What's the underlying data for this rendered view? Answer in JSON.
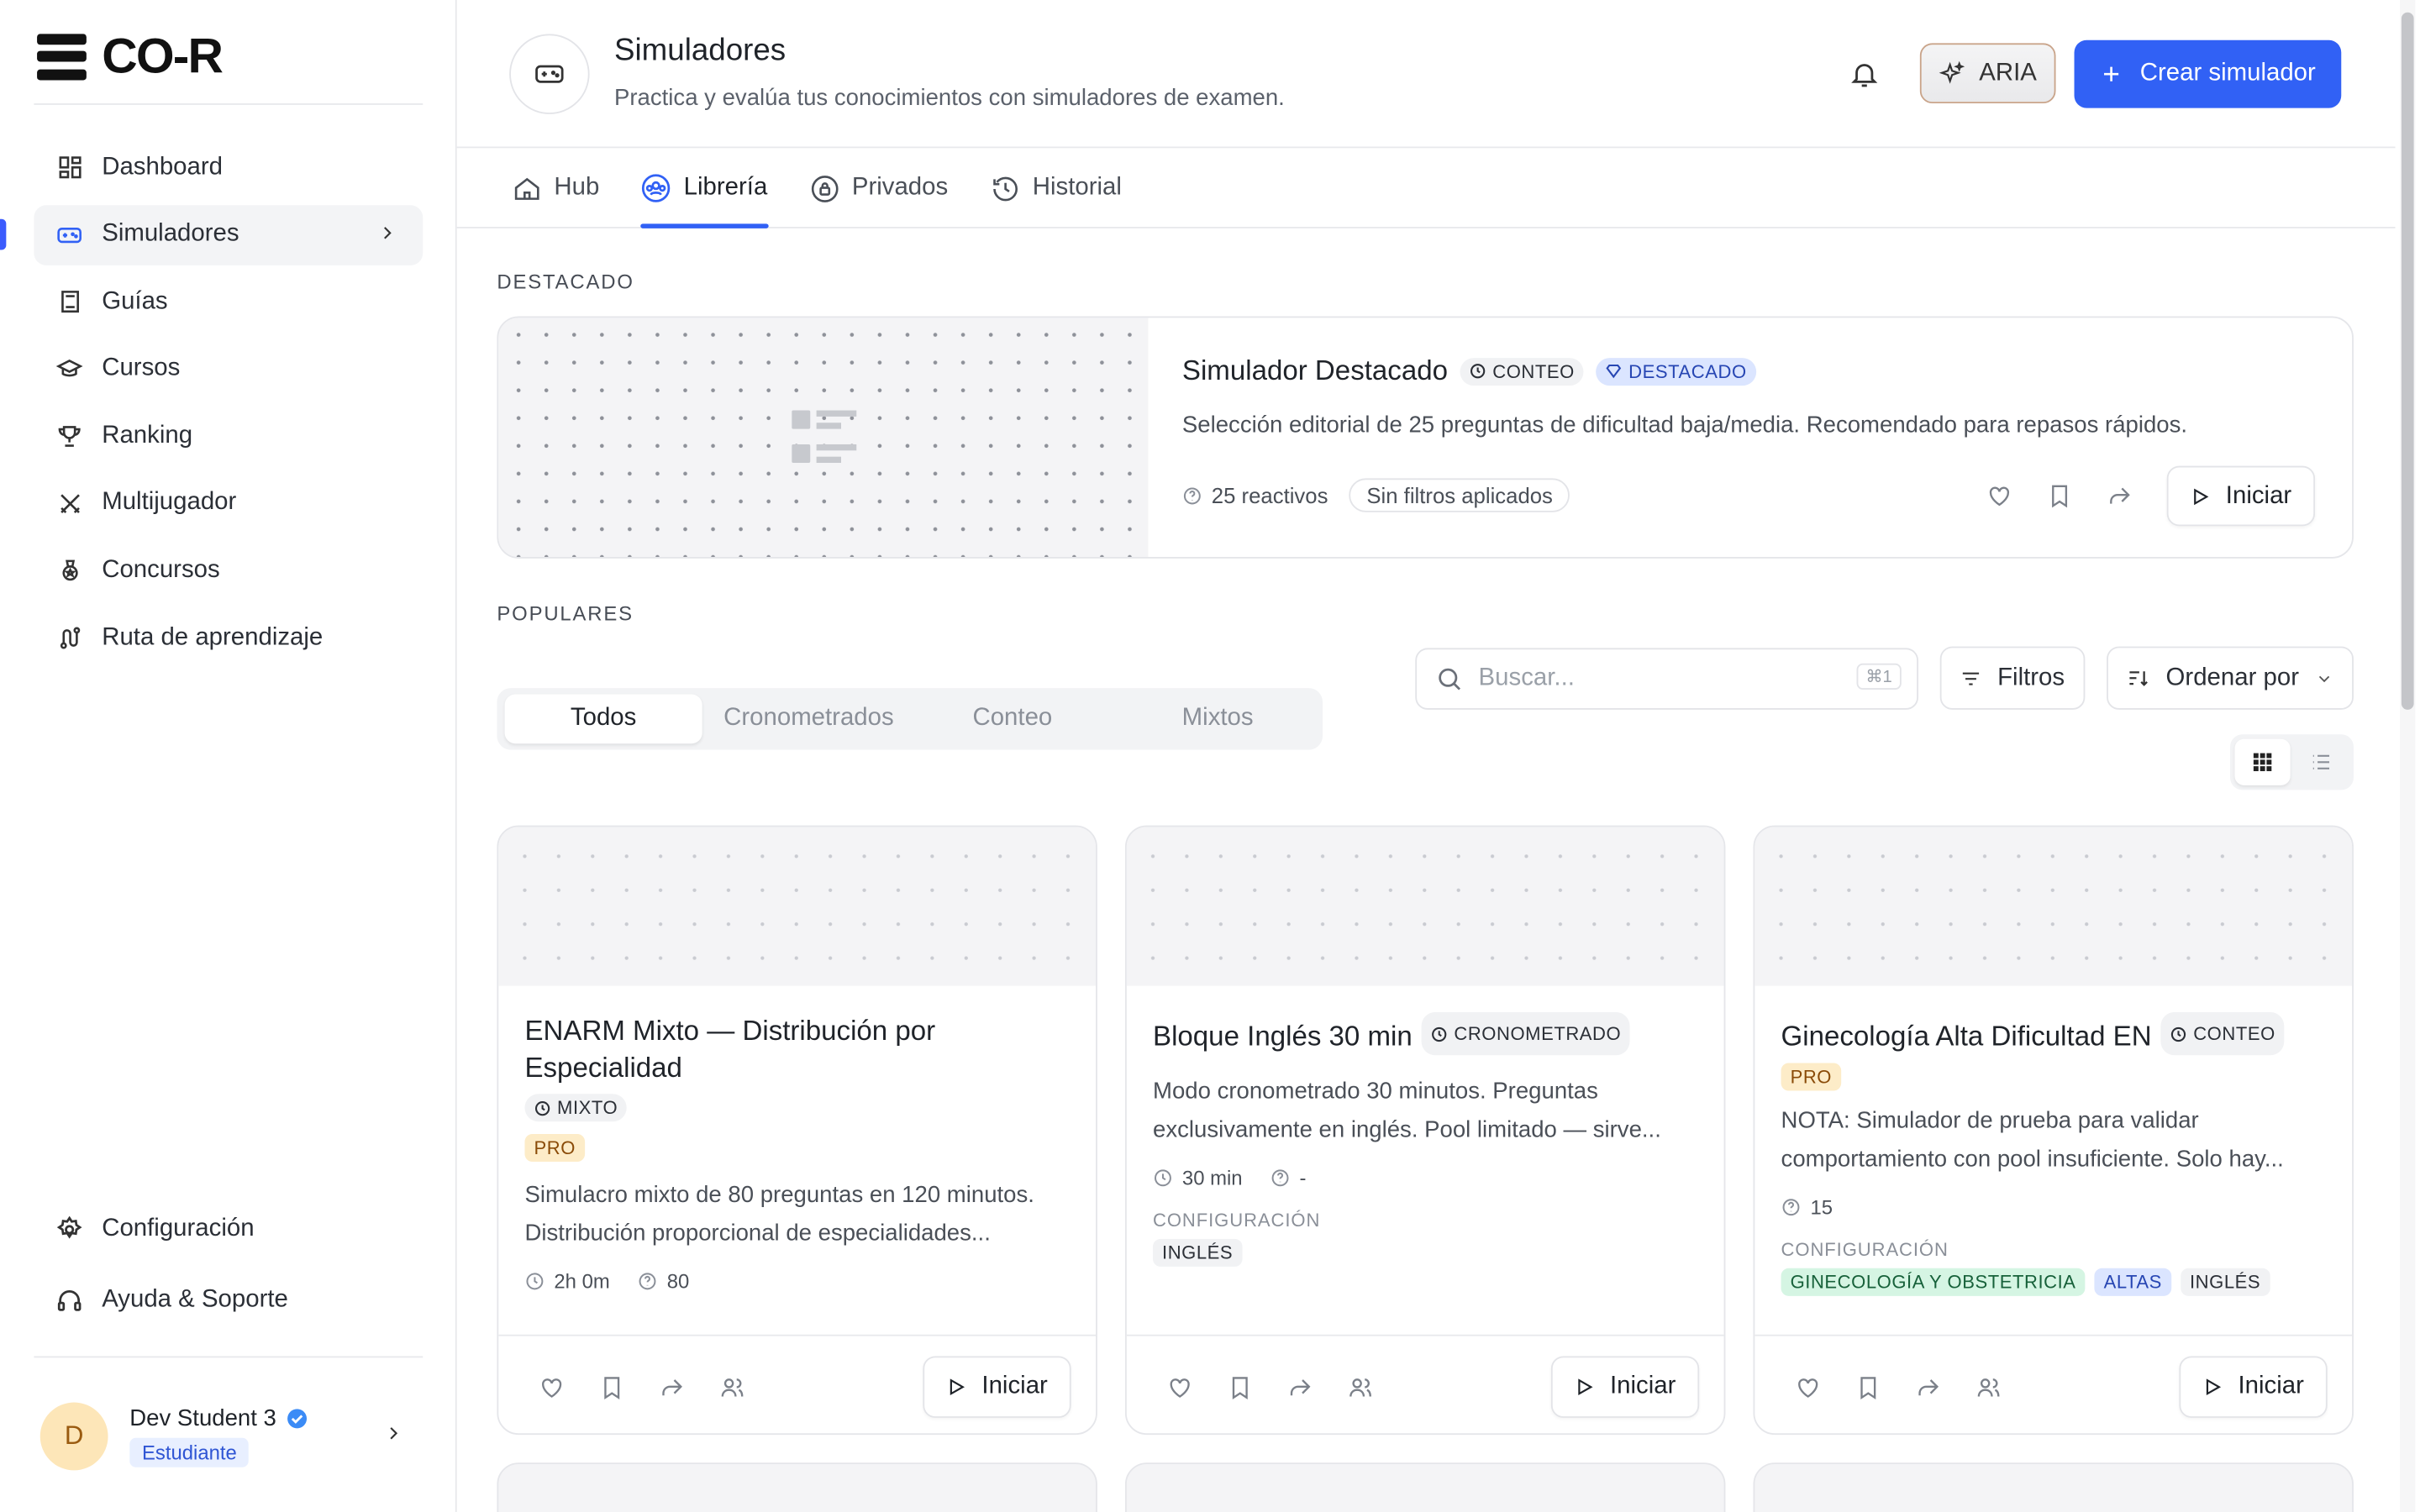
{
  "app": {
    "logo_text": "CO-R"
  },
  "sidebar": {
    "items": [
      {
        "label": "Dashboard",
        "icon": "dashboard-icon"
      },
      {
        "label": "Simuladores",
        "icon": "gamepad-icon",
        "active": true
      },
      {
        "label": "Guías",
        "icon": "book-icon"
      },
      {
        "label": "Cursos",
        "icon": "graduation-cap-icon"
      },
      {
        "label": "Ranking",
        "icon": "trophy-icon"
      },
      {
        "label": "Multijugador",
        "icon": "swords-icon"
      },
      {
        "label": "Concursos",
        "icon": "medal-icon"
      },
      {
        "label": "Ruta de aprendizaje",
        "icon": "route-icon"
      }
    ],
    "bottom_items": [
      {
        "label": "Configuración",
        "icon": "gear-icon"
      },
      {
        "label": "Ayuda & Soporte",
        "icon": "headset-icon"
      }
    ],
    "user": {
      "initial": "D",
      "name": "Dev Student 3",
      "role": "Estudiante"
    }
  },
  "header": {
    "title": "Simuladores",
    "subtitle": "Practica y evalúa tus conocimientos con simuladores de examen.",
    "aria_label": "ARIA",
    "create_label": "Crear simulador"
  },
  "tabs": [
    {
      "label": "Hub"
    },
    {
      "label": "Librería",
      "active": true
    },
    {
      "label": "Privados"
    },
    {
      "label": "Historial"
    }
  ],
  "featured": {
    "section_label": "DESTACADO",
    "title": "Simulador Destacado",
    "badge_mode": "CONTEO",
    "badge_featured": "DESTACADO",
    "description": "Selección editorial de 25 preguntas de dificultad baja/media. Recomendado para repasos rápidos.",
    "items_count": "25 reactivos",
    "filters": "Sin filtros aplicados",
    "start_label": "Iniciar"
  },
  "popular": {
    "section_label": "POPULARES",
    "segments": [
      "Todos",
      "Cronometrados",
      "Conteo",
      "Mixtos"
    ],
    "active_segment": "Todos",
    "search_placeholder": "Buscar...",
    "search_shortcut": "⌘1",
    "filters_label": "Filtros",
    "sort_label": "Ordenar por"
  },
  "cards": [
    {
      "title": "ENARM Mixto — Distribución por Especialidad",
      "mode": "MIXTO",
      "pro": "PRO",
      "description": "Simulacro mixto de 80 preguntas en 120 minutos. Distribución proporcional de especialidades...",
      "duration": "2h 0m",
      "questions": "80",
      "start_label": "Iniciar"
    },
    {
      "title": "Bloque Inglés 30 min",
      "mode": "CRONOMETRADO",
      "description": "Modo cronometrado 30 minutos. Preguntas exclusivamente en inglés. Pool limitado — sirve...",
      "duration": "30 min",
      "questions": "-",
      "config_label": "CONFIGURACIÓN",
      "tags": [
        "INGLÉS"
      ],
      "start_label": "Iniciar"
    },
    {
      "title": "Ginecología Alta Dificultad EN",
      "mode": "CONTEO",
      "pro": "PRO",
      "description": "NOTA: Simulador de prueba para validar comportamiento con pool insuficiente. Solo hay...",
      "questions": "15",
      "config_label": "CONFIGURACIÓN",
      "tags": [
        "GINECOLOGÍA Y OBSTETRICIA",
        "ALTAS",
        "INGLÉS"
      ],
      "start_label": "Iniciar"
    }
  ],
  "colors": {
    "accent": "#3161f5",
    "pro_bg": "#fdecc8",
    "tag_green": "#d5f5e3",
    "tag_blue": "#dbe5ff"
  }
}
